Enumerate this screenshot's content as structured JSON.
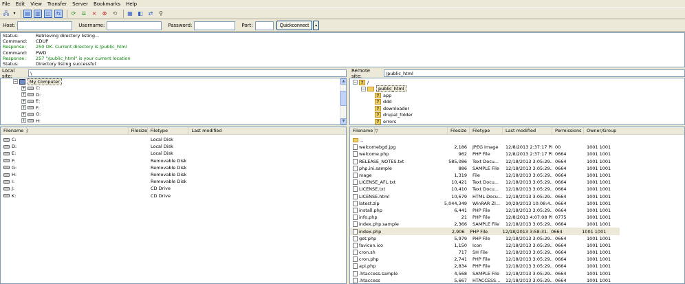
{
  "menu": [
    "File",
    "Edit",
    "View",
    "Transfer",
    "Server",
    "Bookmarks",
    "Help"
  ],
  "toolbar": {
    "icons": [
      "site-manager-icon",
      "dropdown-arrow-icon",
      "message-log-toggle-icon",
      "local-tree-toggle-icon",
      "remote-tree-toggle-icon",
      "transfer-queue-toggle-icon",
      "refresh-icon",
      "process-queue-icon",
      "cancel-icon",
      "disconnect-icon",
      "reconnect-icon",
      "filter-icon",
      "compare-icon",
      "sync-browse-icon",
      "search-icon"
    ]
  },
  "quickconnect": {
    "host_label": "Host:",
    "username_label": "Username:",
    "password_label": "Password:",
    "port_label": "Port:",
    "button": "Quickconnect",
    "dropdown_glyph": "▾"
  },
  "log": [
    {
      "type": "Status:",
      "text": "Retrieving directory listing...",
      "kind": "status"
    },
    {
      "type": "Command:",
      "text": "CDUP",
      "kind": "command"
    },
    {
      "type": "Response:",
      "text": "250 OK. Current directory is /public_html",
      "kind": "resp"
    },
    {
      "type": "Command:",
      "text": "PWD",
      "kind": "command"
    },
    {
      "type": "Response:",
      "text": "257 \"/public_html\" is your current location",
      "kind": "resp"
    },
    {
      "type": "Status:",
      "text": "Directory listing successful",
      "kind": "status"
    }
  ],
  "local": {
    "site_label": "Local site:",
    "path": "\\",
    "tree": {
      "root": "My Computer",
      "drives": [
        "C:",
        "D:",
        "E:",
        "F:",
        "G:",
        "H:"
      ]
    },
    "columns": [
      "Filename",
      "/",
      "Filesize",
      "Filetype",
      "Last modified"
    ],
    "files": [
      {
        "name": "C:",
        "type": "Local Disk"
      },
      {
        "name": "D:",
        "type": "Local Disk"
      },
      {
        "name": "E:",
        "type": "Local Disk"
      },
      {
        "name": "F:",
        "type": "Removable Disk"
      },
      {
        "name": "G:",
        "type": "Removable Disk"
      },
      {
        "name": "H:",
        "type": "Removable Disk"
      },
      {
        "name": "I:",
        "type": "Removable Disk"
      },
      {
        "name": "J:",
        "type": "CD Drive"
      },
      {
        "name": "K:",
        "type": "CD Drive"
      }
    ]
  },
  "remote": {
    "site_label": "Remote site:",
    "path": "/public_html",
    "tree": {
      "root": "/",
      "current": "public_html",
      "children": [
        "app",
        "ddd",
        "downloader",
        "drupal_folder",
        "errors"
      ]
    },
    "columns": [
      "Filename",
      "▽",
      "Filesize",
      "Filetype",
      "Last modified",
      "Permissions",
      "Owner/Group"
    ],
    "files": [
      {
        "name": "..",
        "size": "",
        "type": "",
        "modified": "",
        "perm": "",
        "owner": ""
      },
      {
        "name": "welcomebgd.jpg",
        "size": "2,186",
        "type": "JPEG Image",
        "modified": "12/8/2013 2:37:17 PM",
        "perm": "00",
        "owner": "1001 1001"
      },
      {
        "name": "welcome.php",
        "size": "962",
        "type": "PHP File",
        "modified": "12/8/2013 2:37:17 PM",
        "perm": "0664",
        "owner": "1001 1001"
      },
      {
        "name": "RELEASE_NOTES.txt",
        "size": "585,086",
        "type": "Text Docu...",
        "modified": "12/18/2013 3:05:29...",
        "perm": "0664",
        "owner": "1001 1001"
      },
      {
        "name": "php.ini.sample",
        "size": "886",
        "type": "SAMPLE File",
        "modified": "12/18/2013 3:05:29...",
        "perm": "0664",
        "owner": "1001 1001"
      },
      {
        "name": "mage",
        "size": "1,319",
        "type": "File",
        "modified": "12/18/2013 3:05:29...",
        "perm": "0664",
        "owner": "1001 1001"
      },
      {
        "name": "LICENSE_AFL.txt",
        "size": "10,421",
        "type": "Text Docu...",
        "modified": "12/18/2013 3:05:29...",
        "perm": "0664",
        "owner": "1001 1001"
      },
      {
        "name": "LICENSE.txt",
        "size": "10,410",
        "type": "Text Docu...",
        "modified": "12/18/2013 3:05:29...",
        "perm": "0664",
        "owner": "1001 1001"
      },
      {
        "name": "LICENSE.html",
        "size": "10,679",
        "type": "HTML Docu...",
        "modified": "12/18/2013 3:05:29...",
        "perm": "0664",
        "owner": "1001 1001"
      },
      {
        "name": "latest.zip",
        "size": "5,044,349",
        "type": "WinRAR ZI...",
        "modified": "10/29/2013 10:08:4...",
        "perm": "0664",
        "owner": "1001 1001"
      },
      {
        "name": "install.php",
        "size": "6,441",
        "type": "PHP File",
        "modified": "12/18/2013 3:05:29...",
        "perm": "0664",
        "owner": "1001 1001"
      },
      {
        "name": "info.php",
        "size": "21",
        "type": "PHP File",
        "modified": "12/8/2013 4:07:08 PM",
        "perm": "0775",
        "owner": "1001 1001"
      },
      {
        "name": "index.php.sample",
        "size": "2,366",
        "type": "SAMPLE File",
        "modified": "12/18/2013 3:05:29...",
        "perm": "0664",
        "owner": "1001 1001"
      },
      {
        "name": "index.php",
        "size": "2,906",
        "type": "PHP File",
        "modified": "12/18/2013 3:58:31...",
        "perm": "0664",
        "owner": "1001 1001"
      },
      {
        "name": "get.php",
        "size": "5,979",
        "type": "PHP File",
        "modified": "12/18/2013 3:05:29...",
        "perm": "0664",
        "owner": "1001 1001"
      },
      {
        "name": "favicon.ico",
        "size": "1,150",
        "type": "Icon",
        "modified": "12/18/2013 3:05:29...",
        "perm": "0664",
        "owner": "1001 1001"
      },
      {
        "name": "cron.sh",
        "size": "717",
        "type": "SH File",
        "modified": "12/18/2013 3:05:29...",
        "perm": "0664",
        "owner": "1001 1001"
      },
      {
        "name": "cron.php",
        "size": "2,741",
        "type": "PHP File",
        "modified": "12/18/2013 3:05:29...",
        "perm": "0664",
        "owner": "1001 1001"
      },
      {
        "name": "api.php",
        "size": "2,834",
        "type": "PHP File",
        "modified": "12/18/2013 3:05:29...",
        "perm": "0664",
        "owner": "1001 1001"
      },
      {
        "name": ".htaccess.sample",
        "size": "4,568",
        "type": "SAMPLE File",
        "modified": "12/18/2013 3:05:29...",
        "perm": "0664",
        "owner": "1001 1001"
      },
      {
        "name": ".htaccess",
        "size": "5,667",
        "type": "HTACCESS...",
        "modified": "12/18/2013 3:05:29...",
        "perm": "0664",
        "owner": "1001 1001"
      }
    ],
    "selected_row": 13
  }
}
